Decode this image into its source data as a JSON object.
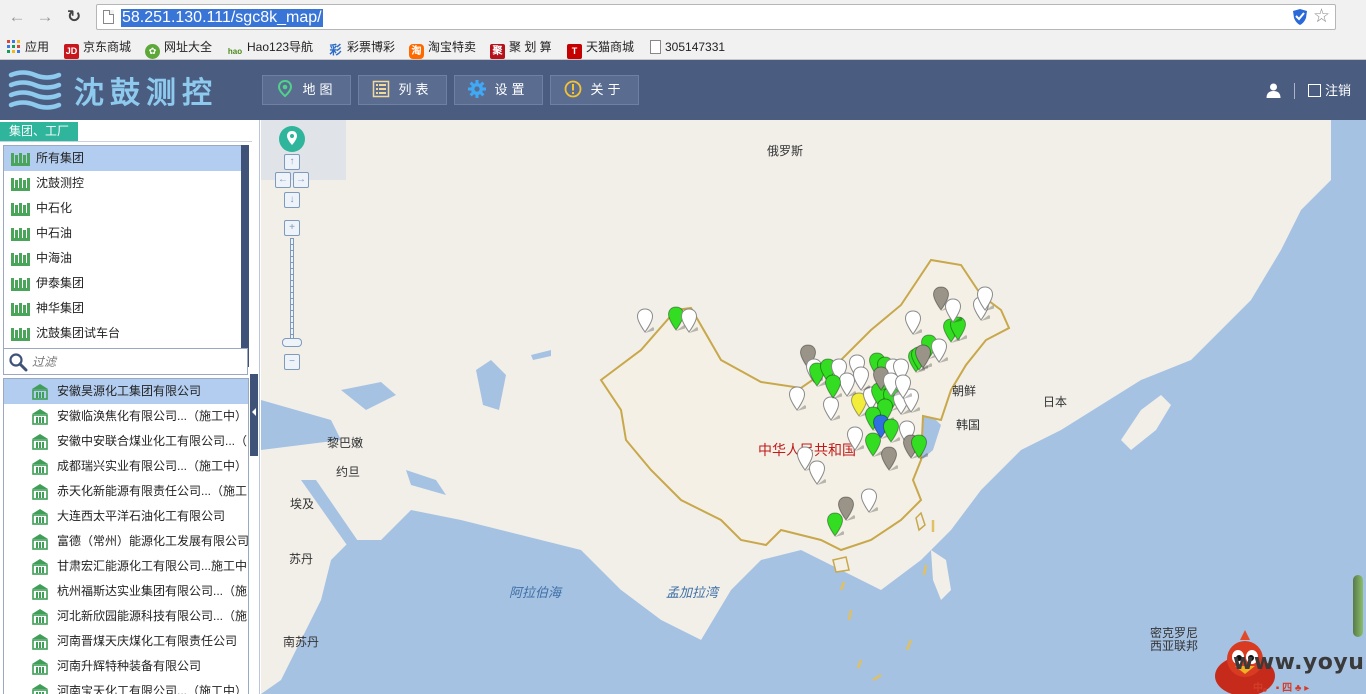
{
  "browser": {
    "url": "58.251.130.111/sgc8k_map/",
    "bookmarks": [
      {
        "label": "应用",
        "icon": "apps-grid-icon"
      },
      {
        "label": "京东商城",
        "icon": "jd-icon"
      },
      {
        "label": "网址大全",
        "icon": "wangzhi-icon"
      },
      {
        "label": "Hao123导航",
        "icon": "hao123-icon"
      },
      {
        "label": "彩票博彩",
        "icon": "caipiao-icon"
      },
      {
        "label": "淘宝特卖",
        "icon": "taobao-icon"
      },
      {
        "label": "聚 划 算",
        "icon": "juhuasuan-icon"
      },
      {
        "label": "天猫商城",
        "icon": "tmall-icon"
      },
      {
        "label": "305147331",
        "icon": "page-icon"
      }
    ]
  },
  "header": {
    "logo_text": "沈鼓测控",
    "nav": [
      {
        "label": "地图",
        "icon": "map-pin-icon"
      },
      {
        "label": "列表",
        "icon": "list-icon"
      },
      {
        "label": "设置",
        "icon": "gear-icon"
      },
      {
        "label": "关于",
        "icon": "info-icon"
      }
    ],
    "logout_label": "注销"
  },
  "sidebar": {
    "tab_label": "集团、工厂",
    "groups": [
      "所有集团",
      "沈鼓测控",
      "中石化",
      "中石油",
      "中海油",
      "伊泰集团",
      "神华集团",
      "沈鼓集团试车台"
    ],
    "selected_group": 0,
    "filter_placeholder": "过滤",
    "companies": [
      "安徽昊源化工集团有限公司",
      "安徽临涣焦化有限公司...（施工中）",
      "安徽中安联合煤业化工有限公司...（",
      "成都瑞兴实业有限公司...（施工中）",
      "赤天化新能源有限责任公司...（施工",
      "大连西太平洋石油化工有限公司",
      "富德（常州）能源化工发展有限公司",
      "甘肃宏汇能源化工有限公司...施工中",
      "杭州福斯达实业集团有限公司...（施",
      "河北新欣园能源科技有限公司...（施",
      "河南晋煤天庆煤化工有限责任公司",
      "河南升辉特种装备有限公司",
      "河南宝天化工有限公司...（施工中）"
    ],
    "selected_company": 0
  },
  "map": {
    "labels": [
      {
        "text": "俄罗斯",
        "kind": "land"
      },
      {
        "text": "中华人民共和国",
        "kind": "china"
      },
      {
        "text": "朝鲜",
        "kind": "land"
      },
      {
        "text": "韩国",
        "kind": "land"
      },
      {
        "text": "日本",
        "kind": "land"
      },
      {
        "text": "黎巴嫩",
        "kind": "land"
      },
      {
        "text": "约旦",
        "kind": "land"
      },
      {
        "text": "埃及",
        "kind": "land"
      },
      {
        "text": "苏丹",
        "kind": "land"
      },
      {
        "text": "南苏丹",
        "kind": "land"
      },
      {
        "text": "阿拉伯海",
        "kind": "sea"
      },
      {
        "text": "孟加拉湾",
        "kind": "sea"
      },
      {
        "text": "密克罗尼西亚联邦",
        "kind": "land"
      }
    ],
    "marker_colors": {
      "running": "#33dd22",
      "offline": "#ffffff",
      "stopped": "#9a9488",
      "warning": "#f2ec3a",
      "selected": "#2f6fe0"
    }
  },
  "watermark": {
    "text": "www.yoyun.org",
    "sub": "中。 ▪ 四 ♣ ▸"
  }
}
